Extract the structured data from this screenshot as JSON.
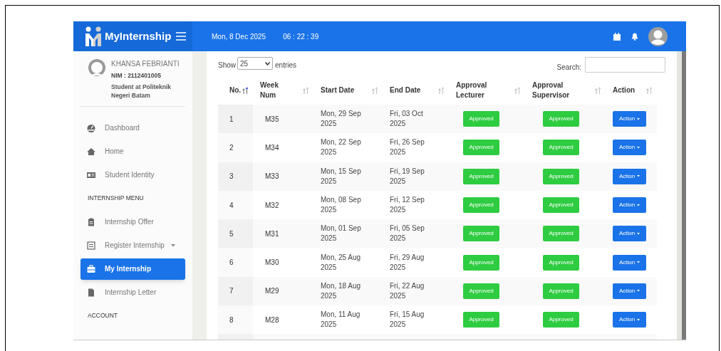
{
  "header": {
    "brand": "MyInternship",
    "date": "Mon, 8 Dec 2025",
    "time": "06 : 22 : 39"
  },
  "profile": {
    "name": "KHANSA FEBRIANTI",
    "nim": "NIM : 2112401005",
    "role": "Student at Politeknik Negeri Batam"
  },
  "sidebar": {
    "items": [
      {
        "kind": "item",
        "label": "Dashboard",
        "selected": false,
        "has_submenu": false
      },
      {
        "kind": "item",
        "label": "Home",
        "selected": false,
        "has_submenu": false
      },
      {
        "kind": "item",
        "label": "Student Identity",
        "selected": false,
        "has_submenu": false
      },
      {
        "kind": "heading",
        "label": "INTERNSHIP MENU"
      },
      {
        "kind": "item",
        "label": "Internship Offer",
        "selected": false,
        "has_submenu": false
      },
      {
        "kind": "item",
        "label": "Register Internship",
        "selected": false,
        "has_submenu": true
      },
      {
        "kind": "item",
        "label": "My Internship",
        "selected": true,
        "has_submenu": false
      },
      {
        "kind": "item",
        "label": "Internship Letter",
        "selected": false,
        "has_submenu": false
      },
      {
        "kind": "heading",
        "label": "ACCOUNT"
      }
    ]
  },
  "table_controls": {
    "show_label": "Show",
    "page_size": "25",
    "entries_label": "entries",
    "search_label": "Search:"
  },
  "table": {
    "columns": [
      {
        "label": "No.",
        "sorted": true
      },
      {
        "label": "Week Num",
        "sorted": false
      },
      {
        "label": "Start Date",
        "sorted": false
      },
      {
        "label": "End Date",
        "sorted": false
      },
      {
        "label": "Approval Lecturer",
        "sorted": false
      },
      {
        "label": "Approval Supervisor",
        "sorted": false
      },
      {
        "label": "Action",
        "sorted": false
      }
    ],
    "rows": [
      {
        "no": "1",
        "week": "M35",
        "start": "Mon, 29 Sep 2025",
        "end": "Fri, 03 Oct 2025",
        "lecturer": "Approved",
        "supervisor": "Approved",
        "action": "Action"
      },
      {
        "no": "2",
        "week": "M34",
        "start": "Mon, 22 Sep 2025",
        "end": "Fri, 26 Sep 2025",
        "lecturer": "Approved",
        "supervisor": "Approved",
        "action": "Action"
      },
      {
        "no": "3",
        "week": "M33",
        "start": "Mon, 15 Sep 2025",
        "end": "Fri, 19 Sep 2025",
        "lecturer": "Approved",
        "supervisor": "Approved",
        "action": "Action"
      },
      {
        "no": "4",
        "week": "M32",
        "start": "Mon, 08 Sep 2025",
        "end": "Fri, 12 Sep 2025",
        "lecturer": "Approved",
        "supervisor": "Approved",
        "action": "Action"
      },
      {
        "no": "5",
        "week": "M31",
        "start": "Mon, 01 Sep 2025",
        "end": "Fri, 05 Sep 2025",
        "lecturer": "Approved",
        "supervisor": "Approved",
        "action": "Action"
      },
      {
        "no": "6",
        "week": "M30",
        "start": "Mon, 25 Aug 2025",
        "end": "Fri, 29 Aug 2025",
        "lecturer": "Approved",
        "supervisor": "Approved",
        "action": "Action"
      },
      {
        "no": "7",
        "week": "M29",
        "start": "Mon, 18 Aug 2025",
        "end": "Fri, 22 Aug 2025",
        "lecturer": "Approved",
        "supervisor": "Approved",
        "action": "Action"
      },
      {
        "no": "8",
        "week": "M28",
        "start": "Mon, 11 Aug 2025",
        "end": "Fri, 15 Aug 2025",
        "lecturer": "Approved",
        "supervisor": "Approved",
        "action": "Action"
      }
    ]
  }
}
